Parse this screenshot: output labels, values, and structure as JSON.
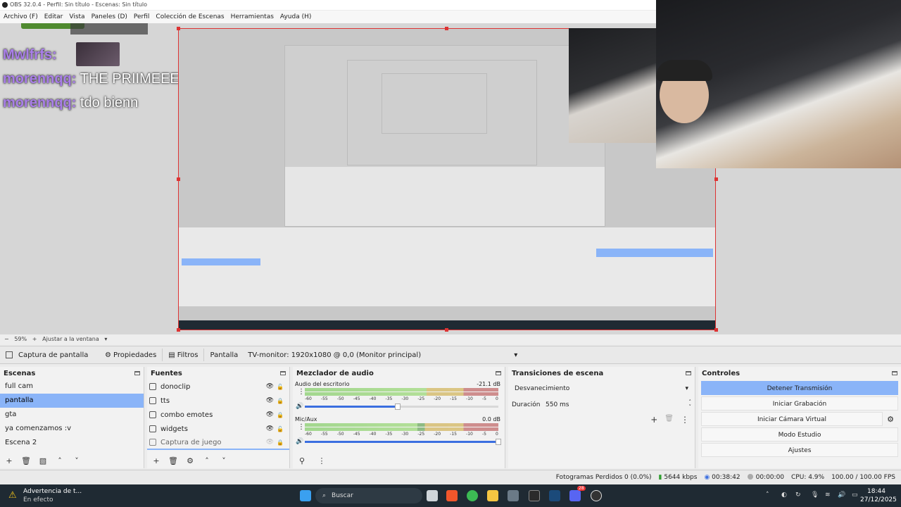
{
  "window": {
    "title": "OBS 32.0.4 - Perfil: Sin título - Escenas: Sin título"
  },
  "menu": [
    "Archivo (F)",
    "Editar",
    "Vista",
    "Paneles (D)",
    "Perfil",
    "Colección de Escenas",
    "Herramientas",
    "Ayuda (H)"
  ],
  "chat": {
    "header_user": "Mwlfrfs:",
    "messages": [
      {
        "user": "morennqq:",
        "text": "THE PRIIMEEE"
      },
      {
        "user": "morennqq:",
        "text": "tdo bienn"
      }
    ]
  },
  "zoom": {
    "level": "59%",
    "fit_label": "Ajustar a la ventana"
  },
  "source_toolbar": {
    "source_name": "Captura de pantalla",
    "properties": "Propiedades",
    "filters": "Filtros",
    "display_label": "Pantalla",
    "display_value": "TV-monitor: 1920x1080 @ 0,0 (Monitor principal)"
  },
  "scenes": {
    "title": "Escenas",
    "items": [
      "full cam",
      "pantalla",
      "gta",
      "ya comenzamos :v",
      "Escena 2"
    ],
    "selected": "pantalla"
  },
  "sources": {
    "title": "Fuentes",
    "items": [
      {
        "name": "donoclip",
        "icon": "media-icon",
        "visible": true,
        "locked": false
      },
      {
        "name": "tts",
        "icon": "browser-icon",
        "visible": true,
        "locked": true
      },
      {
        "name": "combo emotes",
        "icon": "browser-icon",
        "visible": true,
        "locked": true
      },
      {
        "name": "widgets",
        "icon": "browser-icon",
        "visible": true,
        "locked": false
      },
      {
        "name": "Captura de juego",
        "icon": "game-capture-icon",
        "visible": false,
        "locked": true
      }
    ]
  },
  "mixer": {
    "title": "Mezclador de audio",
    "scale": [
      "-60",
      "-55",
      "-50",
      "-45",
      "-40",
      "-35",
      "-30",
      "-25",
      "-20",
      "-15",
      "-10",
      "-5",
      "0"
    ],
    "tracks": [
      {
        "name": "Audio del escritorio",
        "db": "-21.1 dB",
        "level": 0.63,
        "volume": 0.48
      },
      {
        "name": "Mic/Aux",
        "db": "0.0 dB",
        "level": 0.58,
        "volume": 1.0
      }
    ]
  },
  "transitions": {
    "title": "Transiciones de escena",
    "selected": "Desvanecimiento",
    "duration_label": "Duración",
    "duration_value": "550 ms"
  },
  "controls": {
    "title": "Controles",
    "buttons": [
      "Detener Transmisión",
      "Iniciar Grabación",
      "Iniciar Cámara Virtual",
      "Modo Estudio",
      "Ajustes"
    ]
  },
  "status": {
    "dropped": "Fotogramas Perdidos 0 (0.0%)",
    "bitrate": "5644 kbps",
    "stream_time": "00:38:42",
    "rec_time": "00:00:00",
    "cpu": "CPU: 4.9%",
    "fps": "100.00 / 100.00 FPS"
  },
  "taskbar": {
    "notification_title": "Advertencia de t...",
    "notification_sub": "En efecto",
    "search": "Buscar",
    "time": "18:44",
    "date": "27/12/2025",
    "discord_badge": "28"
  },
  "colors": {
    "accent": "#8ab4f8",
    "selection_border": "#dd3333",
    "chat_user": "#a97ee8"
  }
}
